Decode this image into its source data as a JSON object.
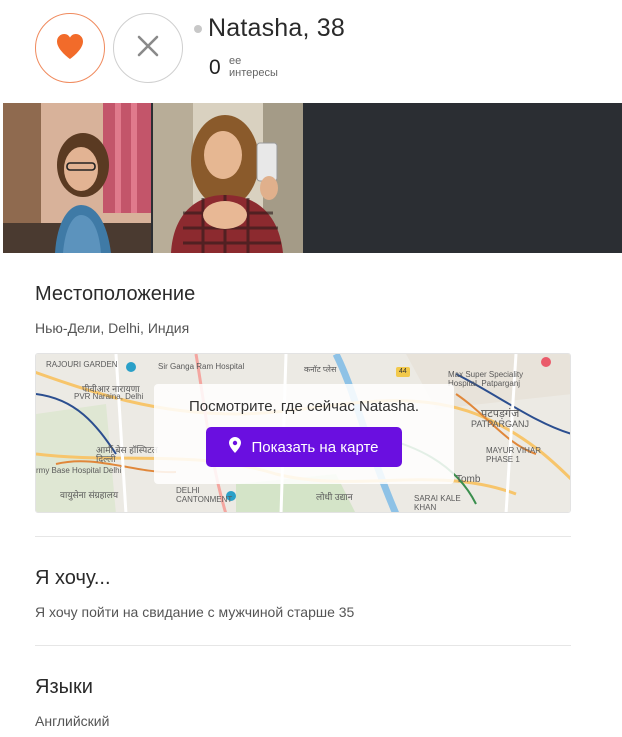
{
  "profile": {
    "name_age": "Natasha, 38",
    "interests_count": "0",
    "interests_label_line1": "ее",
    "interests_label_line2": "интересы"
  },
  "icons": {
    "like": "heart-icon",
    "pass": "close-icon",
    "location": "location-pin-icon"
  },
  "colors": {
    "accent_orange": "#f26b2a",
    "map_button": "#6a0fe0",
    "photo_strip_bg": "#2b2e33"
  },
  "location": {
    "title": "Местоположение",
    "place": "Нью-Дели, Delhi, Индия",
    "map_prompt": "Посмотрите, где сейчас Natasha.",
    "map_button": "Показать на карте",
    "map_labels": [
      "RAJOURI GARDEN",
      "पीवीआर नारायणा",
      "PVR Naraina, Delhi",
      "Sir Ganga Ram Hospital",
      "कनॉट प्लेस",
      "Max Super Speciality Hospital, Patparganj",
      "पटपड़गंज",
      "PATPARGANJ",
      "आर्मी बेस हॉस्पिटल दिल्ली",
      "rmy Base Hospital Delhi",
      "DELHI CANTONMENT",
      "वायुसेना संग्रहालय",
      "लोधी उद्यान",
      "MAYUR VIHAR PHASE 1",
      "SARAI KALE KHAN",
      "Tomb",
      "44"
    ]
  },
  "wants": {
    "title": "Я хочу...",
    "text": "Я хочу пойти на свидание с мужчиной старше 35"
  },
  "languages": {
    "title": "Языки",
    "text": "Английский"
  }
}
